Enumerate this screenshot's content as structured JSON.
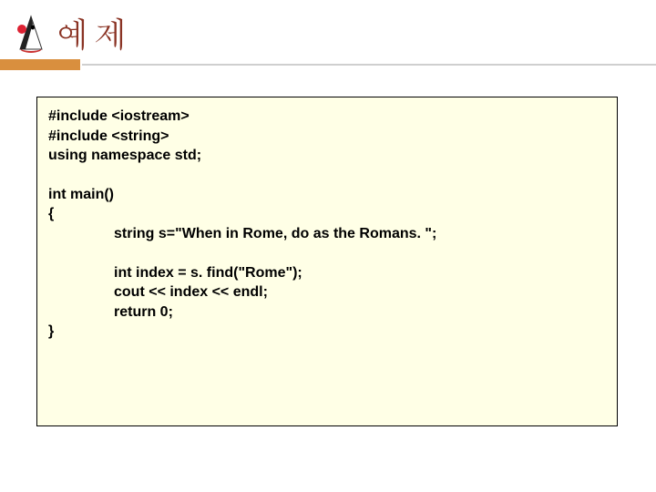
{
  "header": {
    "title": "예제",
    "icon_name": "java-duke-icon"
  },
  "code": {
    "lines": [
      "#include <iostream>",
      "#include <string>",
      "using namespace std;",
      "",
      "int main()",
      "{"
    ],
    "indented1": [
      "string s=\"When in Rome, do as the Romans. \";"
    ],
    "indented2": [
      "int index = s. find(\"Rome\");",
      "cout << index << endl;",
      "return 0;"
    ],
    "close": "}"
  }
}
